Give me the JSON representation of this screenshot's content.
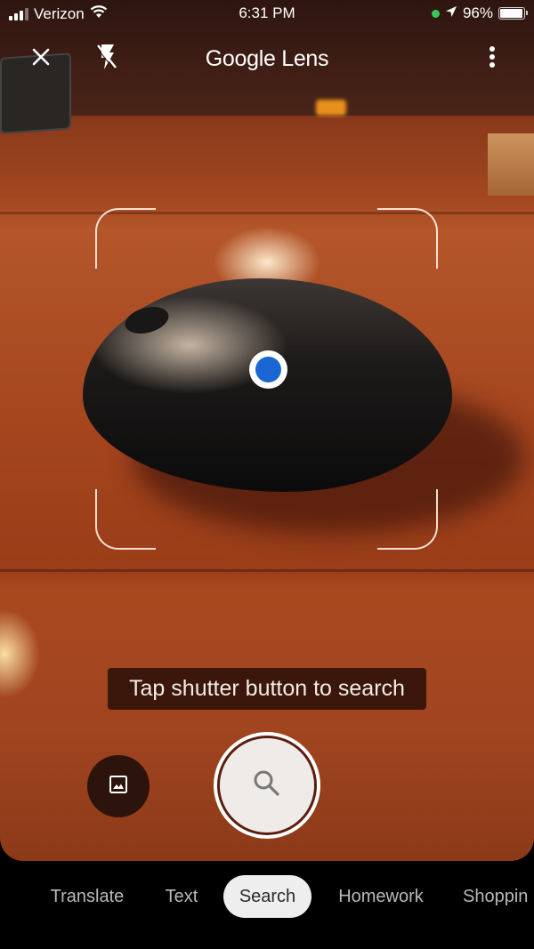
{
  "status_bar": {
    "carrier": "Verizon",
    "time": "6:31 PM",
    "battery_percent": "96%",
    "battery_level": 0.96,
    "icons": [
      "signal-icon",
      "wifi-icon",
      "camera-in-use-dot-icon",
      "location-arrow-icon",
      "battery-icon"
    ]
  },
  "app_bar": {
    "title": "Google Lens",
    "close_icon": "close-icon",
    "flash_icon": "flash-off-icon",
    "menu_icon": "more-vert-icon"
  },
  "viewfinder": {
    "hint": "Tap shutter button to search",
    "focus_dot_color": "#1a66d2"
  },
  "controls": {
    "gallery_icon": "image-icon",
    "shutter_icon": "search-icon"
  },
  "modes": {
    "items": [
      {
        "label": "Translate",
        "active": false
      },
      {
        "label": "Text",
        "active": false
      },
      {
        "label": "Search",
        "active": true
      },
      {
        "label": "Homework",
        "active": false
      },
      {
        "label": "Shoppin",
        "active": false
      }
    ]
  }
}
